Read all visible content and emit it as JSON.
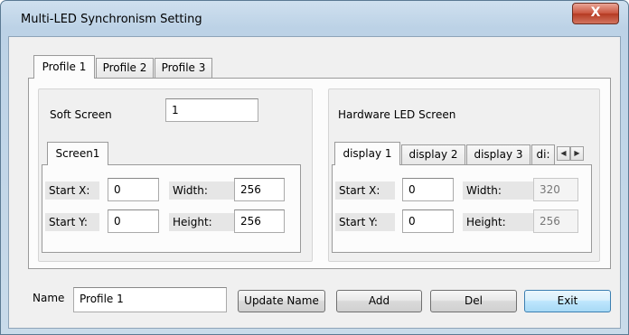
{
  "window": {
    "title": "Multi-LED Synchronism Setting",
    "close_glyph": "X"
  },
  "profile_tabs": [
    {
      "label": "Profile 1"
    },
    {
      "label": "Profile 2"
    },
    {
      "label": "Profile 3"
    }
  ],
  "soft": {
    "label": "Soft Screen",
    "count": "1",
    "tab_label": "Screen1",
    "start_x_label": "Start X:",
    "start_x": "0",
    "start_y_label": "Start Y:",
    "start_y": "0",
    "width_label": "Width:",
    "width": "256",
    "height_label": "Height:",
    "height": "256"
  },
  "hardware": {
    "label": "Hardware LED Screen",
    "tabs": [
      {
        "label": "display 1"
      },
      {
        "label": "display 2"
      },
      {
        "label": "display 3"
      },
      {
        "label": "di:"
      }
    ],
    "start_x_label": "Start X:",
    "start_x": "0",
    "start_y_label": "Start Y:",
    "start_y": "0",
    "width_label": "Width:",
    "width": "320",
    "height_label": "Height:",
    "height": "256",
    "scroll_left_glyph": "◀",
    "scroll_right_glyph": "▶"
  },
  "footer": {
    "name_label": "Name",
    "name_value": "Profile 1",
    "update_button": "Update Name",
    "add_button": "Add",
    "del_button": "Del",
    "exit_button": "Exit"
  },
  "colors": {
    "window_frame": "#bcd2e6",
    "close_button": "#c9533d",
    "default_button": "#bee6fd"
  }
}
